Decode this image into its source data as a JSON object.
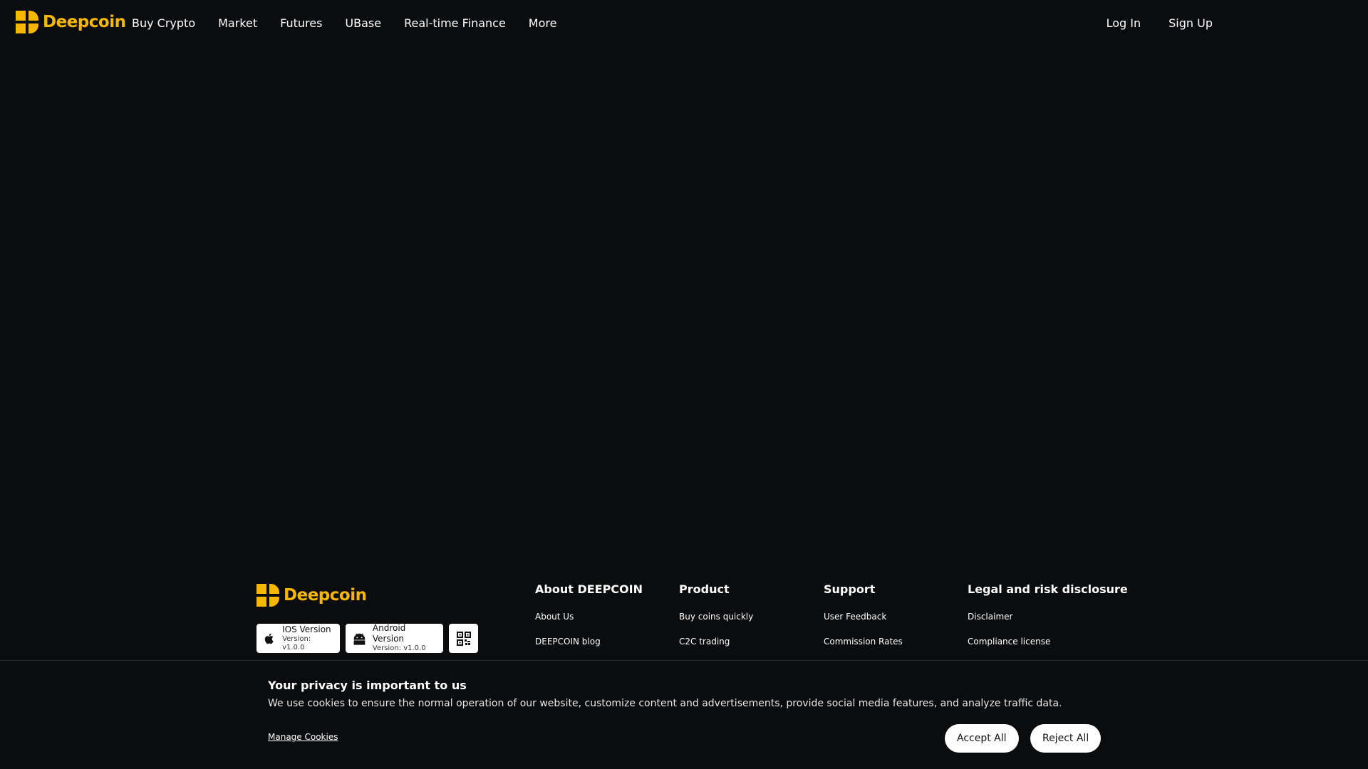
{
  "brand": {
    "name": "Deepcoin",
    "color": "#f5b700"
  },
  "nav": {
    "items": [
      {
        "label": "Buy Crypto"
      },
      {
        "label": "Market"
      },
      {
        "label": "Futures"
      },
      {
        "label": "UBase"
      },
      {
        "label": "Real-time Finance"
      },
      {
        "label": "More"
      }
    ]
  },
  "auth": {
    "login": "Log In",
    "signup": "Sign Up"
  },
  "footer": {
    "apps": {
      "ios": {
        "title": "IOS Version",
        "version": "Version: v1.0.0"
      },
      "android": {
        "title": "Android Version",
        "version": "Version: v1.0.0"
      }
    },
    "columns": [
      {
        "heading": "About DEEPCOIN",
        "links": [
          "About Us",
          "DEEPCOIN blog"
        ]
      },
      {
        "heading": "Product",
        "links": [
          "Buy coins quickly",
          "C2C trading"
        ]
      },
      {
        "heading": "Support",
        "links": [
          "User Feedback",
          "Commission Rates"
        ]
      },
      {
        "heading": "Legal and risk disclosure",
        "links": [
          "Disclaimer",
          "Compliance license"
        ]
      }
    ]
  },
  "cookie": {
    "title": "Your privacy is important to us",
    "text": "We use cookies to ensure the normal operation of our website, customize content and advertisements, provide social media features, and analyze traffic data.",
    "manage": "Manage Cookies",
    "accept": "Accept All",
    "reject": "Reject All"
  },
  "colors": {
    "background": "#0b0c0e",
    "accent": "#f5b700",
    "button_bg": "#ffffff"
  },
  "icons": [
    "deepcoin-logo-icon",
    "apple-icon",
    "android-icon",
    "qr-code-icon"
  ]
}
